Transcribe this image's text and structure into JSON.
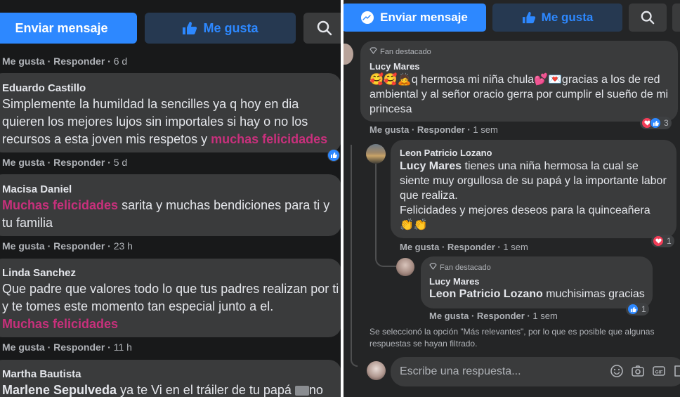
{
  "left": {
    "actions": {
      "send_message": "Enviar mensaje",
      "like_page": "Me gusta"
    },
    "comments": [
      {
        "meta": {
          "like": "Me gusta",
          "reply": "Responder",
          "time": "6 d"
        }
      },
      {
        "author": "Eduardo Castillo",
        "text": "Simplemente la humildad la sencilles ya q hoy en dia quieren los mejores lujos sin importales si hay o no los recursos a esta joven mis respetos y ",
        "highlight": "muchas felicidades",
        "meta": {
          "like": "Me gusta",
          "reply": "Responder",
          "time": "5 d"
        }
      },
      {
        "author": "Macisa Daniel",
        "highlight": "Muchas felicidades",
        "text": " sarita y muchas bendiciones para ti y tu familia",
        "meta": {
          "like": "Me gusta",
          "reply": "Responder",
          "time": "23 h"
        }
      },
      {
        "author": "Linda Sanchez",
        "text": "Que padre que valores todo lo que tus padres realizan por ti y te tomes este momento tan especial junto a el.",
        "highlight": "Muchas felicidades",
        "meta": {
          "like": "Me gusta",
          "reply": "Responder",
          "time": "11 h"
        }
      },
      {
        "author": "Martha Bautista",
        "mention": "Marlene Sepulveda",
        "text": " ya te Vi en el tráiler de tu papá",
        "trail": "no"
      }
    ]
  },
  "right": {
    "actions": {
      "send_message": "Enviar mensaje",
      "like_page": "Me gusta"
    },
    "comment1": {
      "badge": "Fan destacado",
      "author": "Lucy Mares",
      "emoji_lead": "🥰🥰🙇",
      "text_a": "q hermosa mi niña chula",
      "emoji_mid": "💕💌",
      "text_b": "gracias a los de red ambiental y al señor oracio gerra por cumplir el sueño de mi princesa",
      "meta": {
        "like": "Me gusta",
        "reply": "Responder",
        "time": "1 sem"
      },
      "reaction_count": "3"
    },
    "reply1": {
      "author": "Leon Patricio Lozano",
      "mention": "Lucy Mares",
      "text": " tienes una niña hermosa la cual se siente muy orgullosa de su papá y la importante labor que realiza.",
      "text2": "Felicidades y mejores deseos para la quinceañera",
      "emoji": "👏👏",
      "meta": {
        "like": "Me gusta",
        "reply": "Responder",
        "time": "1 sem"
      },
      "reaction_count": "1"
    },
    "reply2": {
      "badge": "Fan destacado",
      "author": "Lucy Mares",
      "mention": "Leon Patricio Lozano",
      "text": " muchisimas gracias",
      "meta": {
        "like": "Me gusta",
        "reply": "Responder",
        "time": "1 sem"
      },
      "reaction_count": "1"
    },
    "notice": "Se seleccionó la opción \"Más relevantes\", por lo que es posible que algunas respuestas se hayan filtrado.",
    "reply_input": {
      "placeholder": "Escribe una respuesta..."
    },
    "colors": {
      "accent": "#2d88ff",
      "highlight": "#c8307c",
      "bubble": "#3a3b3c"
    }
  }
}
